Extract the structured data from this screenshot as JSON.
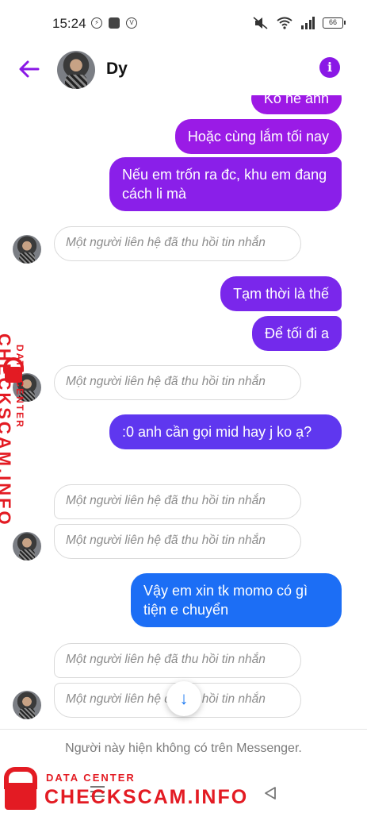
{
  "status_bar": {
    "time": "15:24",
    "battery": "66",
    "icons": [
      "messenger-icon",
      "shopping-bag-icon",
      "volte-icon",
      "mute-icon",
      "wifi-icon",
      "signal-icon",
      "battery-icon"
    ]
  },
  "header": {
    "contact_name": "Dy",
    "info_glyph": "i",
    "accent_color": "#8a18e6"
  },
  "messages": [
    {
      "side": "out",
      "text": "Ko hề anh"
    },
    {
      "side": "out",
      "text": "Hoặc cùng lắm tối nay"
    },
    {
      "side": "out",
      "text": "Nếu em trốn ra đc, khu em đang cách li mà"
    },
    {
      "side": "in",
      "text": "Một người liên hệ đã thu hồi tin nhắn"
    },
    {
      "side": "out",
      "text": "Tạm thời là thế"
    },
    {
      "side": "out",
      "text": "Để tối đi a"
    },
    {
      "side": "in",
      "text": "Một người liên hệ đã thu hồi tin nhắn"
    },
    {
      "side": "out",
      "text": ":0 anh cần gọi mid hay j ko ạ?"
    },
    {
      "side": "in",
      "text": "Một người liên hệ đã thu hồi tin nhắn"
    },
    {
      "side": "in",
      "text": "Một người liên hệ đã thu hồi tin nhắn"
    },
    {
      "side": "out",
      "text": "Vậy em xin tk momo có gì tiện e chuyển"
    },
    {
      "side": "in",
      "text": "Một người liên hệ đã thu hồi tin nhắn"
    },
    {
      "side": "in",
      "text": "Một người liên hệ đã thu hồi tin nhắn"
    }
  ],
  "scroll_down_glyph": "↓",
  "footer": {
    "unavailable_text": "Người này hiện không có trên Messenger."
  },
  "watermark": {
    "small": "DATA CENTER",
    "big": "CHECKSCAM.INFO",
    "color": "#e31b23"
  },
  "bubble_colors": [
    "#9a1be6",
    "#8a1fe9",
    "#6a33ef",
    "#3b4ff2",
    "#1c6ef5"
  ]
}
